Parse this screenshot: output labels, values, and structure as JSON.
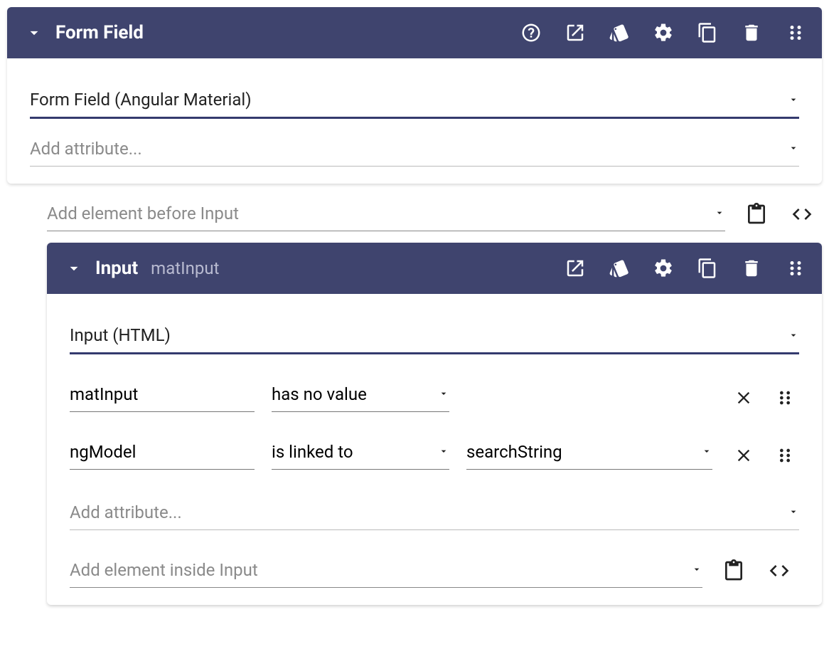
{
  "outer": {
    "title": "Form Field",
    "type_value": "Form Field (Angular Material)",
    "add_attr_placeholder": "Add attribute..."
  },
  "insert_before": {
    "placeholder": "Add element before Input"
  },
  "inner": {
    "title": "Input",
    "subtitle": "matInput",
    "type_value": "Input (HTML)",
    "attrs": [
      {
        "name": "matInput",
        "op": "has no value",
        "value": ""
      },
      {
        "name": "ngModel",
        "op": "is linked to",
        "value": "searchString"
      }
    ],
    "add_attr_placeholder": "Add attribute...",
    "insert_inside_placeholder": "Add element inside Input"
  }
}
